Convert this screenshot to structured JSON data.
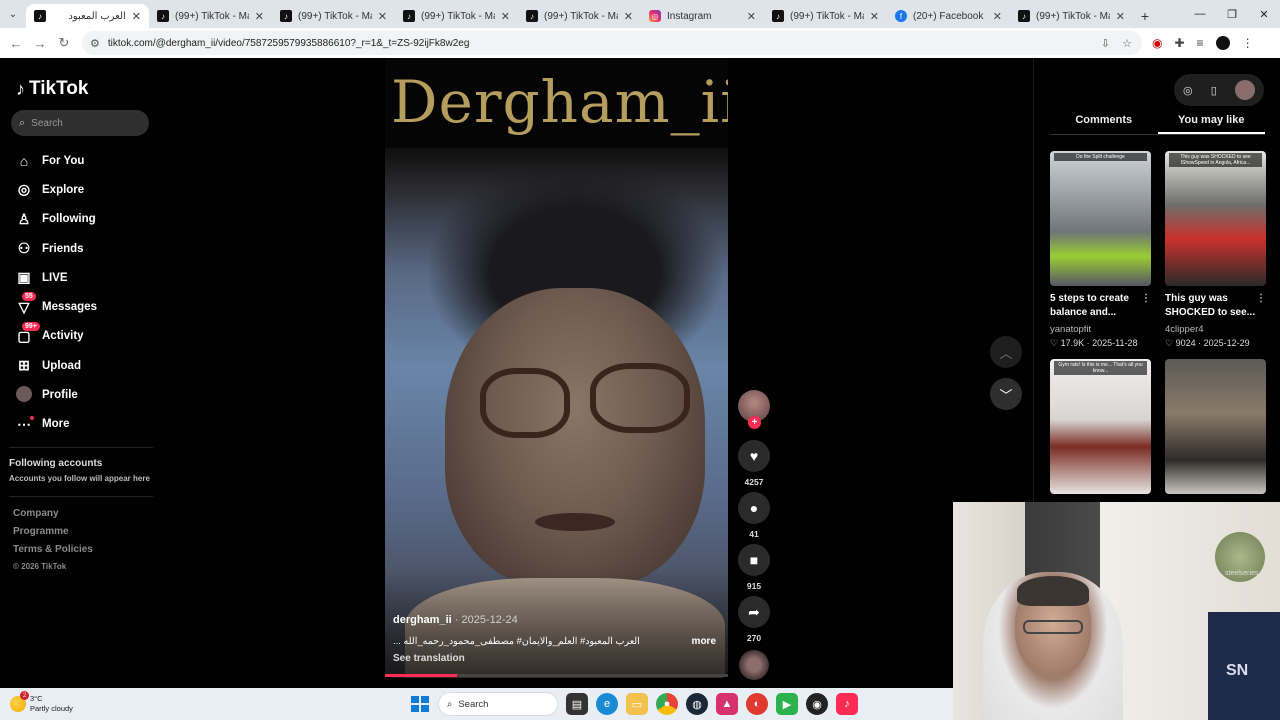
{
  "browser": {
    "tabs": [
      {
        "title": "العرب المعبود",
        "icon": "tiktok-icon",
        "active": true
      },
      {
        "title": "(99+) TikTok - Make Y",
        "icon": "tiktok-icon",
        "active": false
      },
      {
        "title": "(99+) TikTok - Make Y",
        "icon": "tiktok-icon",
        "active": false
      },
      {
        "title": "(99+) TikTok - Make Y",
        "icon": "tiktok-icon",
        "active": false
      },
      {
        "title": "(99+) TikTok - Make Y",
        "icon": "tiktok-icon",
        "active": false
      },
      {
        "title": "Instagram",
        "icon": "instagram-icon",
        "active": false
      },
      {
        "title": "(99+) TikTok - Make Y",
        "icon": "tiktok-icon",
        "active": false
      },
      {
        "title": "(20+) Facebook",
        "icon": "facebook-icon",
        "active": false
      },
      {
        "title": "(99+) TikTok - Make Y",
        "icon": "tiktok-icon",
        "active": false
      }
    ],
    "url": "tiktok.com/@dergham_ii/video/7587259579935886610?_r=1&_t=ZS-92ijFk8w2eg"
  },
  "sidebar": {
    "logo": "TikTok",
    "search_placeholder": "Search",
    "nav": [
      {
        "label": "For You",
        "icon": "home-icon",
        "badge": ""
      },
      {
        "label": "Explore",
        "icon": "compass-icon",
        "badge": ""
      },
      {
        "label": "Following",
        "icon": "following-icon",
        "badge": ""
      },
      {
        "label": "Friends",
        "icon": "friends-icon",
        "badge": ""
      },
      {
        "label": "LIVE",
        "icon": "live-icon",
        "badge": ""
      },
      {
        "label": "Messages",
        "icon": "messages-icon",
        "badge": "55"
      },
      {
        "label": "Activity",
        "icon": "activity-icon",
        "badge": "99+"
      },
      {
        "label": "Upload",
        "icon": "upload-icon",
        "badge": ""
      },
      {
        "label": "Profile",
        "icon": "avatar",
        "badge": ""
      },
      {
        "label": "More",
        "icon": "more-icon",
        "badge": ""
      }
    ],
    "following_title": "Following accounts",
    "following_sub": "Accounts you follow will appear here",
    "footer": [
      "Company",
      "Programme",
      "Terms & Policies"
    ],
    "copyright": "© 2026 TikTok"
  },
  "video": {
    "watermark": "Dergham_ii",
    "author": "dergham_ii",
    "date": " · 2025-12-24",
    "caption": "العرب المعبود# العلم_والايمان# مصطفى_محمود_رحمه_الله ...",
    "more": "more",
    "see_translation": "See translation",
    "progress_percent": 21
  },
  "actions": {
    "likes": "4257",
    "comments": "41",
    "saves": "915",
    "shares": "270"
  },
  "right_panel": {
    "tabs": [
      "Comments",
      "You may like"
    ],
    "active_tab": "You may like",
    "cards": [
      {
        "overlay": "Do the Split challenge",
        "title": "5 steps to create balance and...",
        "author": "yanatopfit",
        "likes": "17.9K",
        "date": "2025-11-28"
      },
      {
        "overlay": "This guy was SHOCKED to see IShowSpeed in Angola, Africa...",
        "title": "This guy was SHOCKED to see...",
        "author": "4clipper4",
        "likes": "9024",
        "date": "2025-12-29"
      },
      {
        "overlay": "Gym rats! Is this is me... That's all you know...",
        "title": "",
        "author": "",
        "likes": "",
        "date": ""
      },
      {
        "overlay": "",
        "title": "",
        "author": "",
        "likes": "",
        "date": ""
      }
    ]
  },
  "webcam": {
    "shirt_text": "SN",
    "poster_text": "steelseries"
  },
  "taskbar": {
    "temp": "3°C",
    "weather": "Partly cloudy",
    "weather_badge": "2",
    "search": "Search"
  },
  "colors": {
    "accent": "#fe2c55",
    "watermark": "#b59d5e"
  }
}
